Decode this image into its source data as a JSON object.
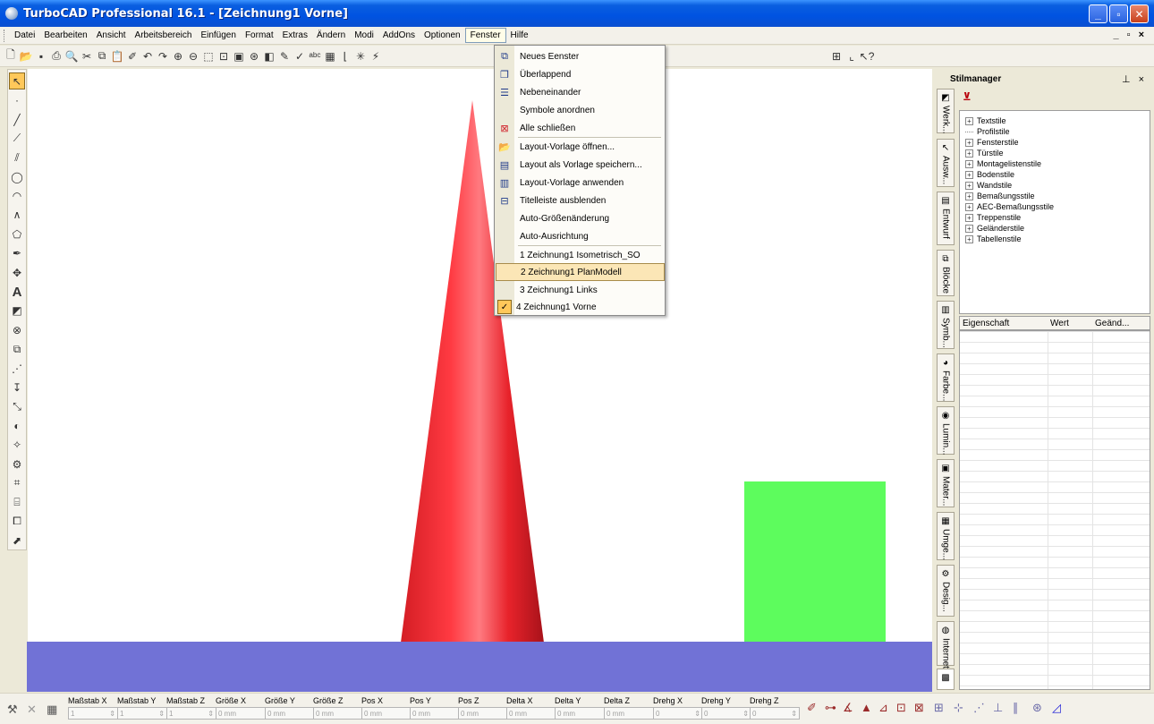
{
  "window": {
    "title": "TurboCAD Professional 16.1 - [Zeichnung1 Vorne]",
    "buttons": [
      "_",
      "▫",
      "✕"
    ]
  },
  "menubar": {
    "items": [
      "Datei",
      "Bearbeiten",
      "Ansicht",
      "Arbeitsbereich",
      "Einfügen",
      "Format",
      "Extras",
      "Ändern",
      "Modi",
      "AddOns",
      "Optionen",
      "Fenster",
      "Hilfe"
    ],
    "active": "Fenster",
    "mdi_controls": "_ ▫ ×"
  },
  "fenster_menu": {
    "items": [
      {
        "label": "Neues Eenster",
        "icon": "new-window-icon"
      },
      {
        "label": "Überlappend",
        "icon": "cascade-icon"
      },
      {
        "label": "Nebeneinander",
        "icon": "tile-icon"
      },
      {
        "label": "Symbole anordnen",
        "icon": ""
      },
      {
        "label": "Alle schließen",
        "icon": "close-all-icon"
      },
      {
        "label": "Layout-Vorlage öffnen...",
        "icon": "open-template-icon"
      },
      {
        "label": "Layout als Vorlage speichern...",
        "icon": "save-template-icon"
      },
      {
        "label": "Layout-Vorlage anwenden",
        "icon": "apply-template-icon"
      },
      {
        "label": "Titelleiste ausblenden",
        "icon": "titlebar-icon"
      },
      {
        "label": "Auto-Größenänderung",
        "icon": ""
      },
      {
        "label": "Auto-Ausrichtung",
        "icon": ""
      },
      {
        "label": "1 Zeichnung1 Isometrisch_SO",
        "icon": ""
      },
      {
        "label": "2 Zeichnung1 PlanModell",
        "icon": ""
      },
      {
        "label": "3 Zeichnung1 Links",
        "icon": ""
      },
      {
        "label": "4 Zeichnung1 Vorne",
        "icon": "check-icon"
      }
    ],
    "highlighted_index": 12,
    "checked_index": 14
  },
  "stilmanager": {
    "title": "Stilmanager",
    "pin": "⊥ ×",
    "tabs": [
      "Werk...",
      "Ausw...",
      "Entwurf",
      "Blöcke",
      "Symb...",
      "Farbe...",
      "Lumin...",
      "Mater...",
      "Umge...",
      "Desig...",
      "Internet",
      "Stilma..."
    ],
    "tree": [
      {
        "label": "Textstile",
        "expandable": true
      },
      {
        "label": "Profilstile",
        "expandable": false
      },
      {
        "label": "Fensterstile",
        "expandable": true
      },
      {
        "label": "Türstile",
        "expandable": true
      },
      {
        "label": "Montagelistenstile",
        "expandable": true
      },
      {
        "label": "Bodenstile",
        "expandable": true
      },
      {
        "label": "Wandstile",
        "expandable": true
      },
      {
        "label": "Bemaßungsstile",
        "expandable": true
      },
      {
        "label": "AEC-Bemaßungsstile",
        "expandable": true
      },
      {
        "label": "Treppenstile",
        "expandable": true
      },
      {
        "label": "Geländerstile",
        "expandable": true
      },
      {
        "label": "Tabellenstile",
        "expandable": true
      }
    ],
    "columns": [
      "Eigenschaft",
      "Wert",
      "Geänd..."
    ]
  },
  "inspector": {
    "fields": [
      {
        "label": "Maßstab X",
        "value": "1"
      },
      {
        "label": "Maßstab Y",
        "value": "1"
      },
      {
        "label": "Maßstab Z",
        "value": "1"
      },
      {
        "label": "Größe X",
        "value": "0 mm"
      },
      {
        "label": "Größe Y",
        "value": "0 mm"
      },
      {
        "label": "Größe Z",
        "value": "0 mm"
      },
      {
        "label": "Pos X",
        "value": "0 mm"
      },
      {
        "label": "Pos Y",
        "value": "0 mm"
      },
      {
        "label": "Pos Z",
        "value": "0 mm"
      },
      {
        "label": "Delta X",
        "value": "0 mm"
      },
      {
        "label": "Delta Y",
        "value": "0 mm"
      },
      {
        "label": "Delta Z",
        "value": "0 mm"
      },
      {
        "label": "Drehg X",
        "value": "0"
      },
      {
        "label": "Drehg Y",
        "value": "0"
      },
      {
        "label": "Drehg Z",
        "value": "0"
      }
    ]
  },
  "colors": {
    "cone": "#e8232b",
    "box": "#5dfc5d",
    "ground": "#7172d6",
    "titlebar": "#0053e1"
  }
}
